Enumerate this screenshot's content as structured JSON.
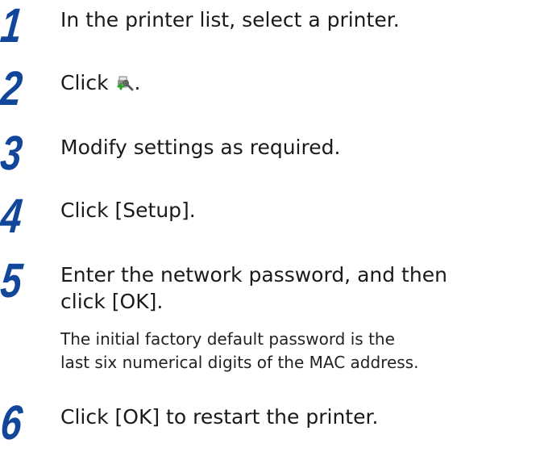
{
  "steps": [
    {
      "number": "1",
      "text": "In the printer list, select a printer."
    },
    {
      "number": "2",
      "text_before": "Click ",
      "icon": "printer-settings-icon",
      "text_after": "."
    },
    {
      "number": "3",
      "text": "Modify settings as required."
    },
    {
      "number": "4",
      "text": "Click [Setup]."
    },
    {
      "number": "5",
      "text_line1": "Enter the network password, and then",
      "text_line2": "click [OK].",
      "note_line1": "The initial factory default password is the",
      "note_line2": "last six numerical digits of the MAC address."
    },
    {
      "number": "6",
      "text": "Click [OK] to restart the printer."
    }
  ],
  "colors": {
    "step_number": "#12469a",
    "body_text": "#1a1a1a"
  }
}
